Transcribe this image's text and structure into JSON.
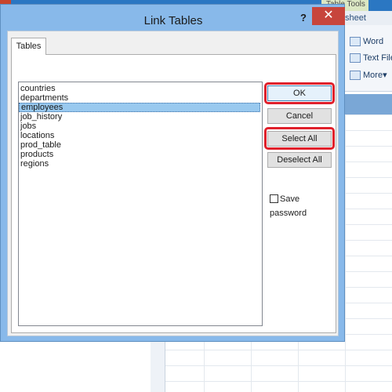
{
  "background": {
    "context_tab": "Table Tools",
    "ribbon_tab": "sheet",
    "ribbon_items": [
      "Word",
      "Text File",
      "More"
    ],
    "more_arrow": "▾",
    "close_glyph": "✕"
  },
  "dialog": {
    "title": "Link Tables",
    "help_glyph": "?",
    "close_glyph": "✕",
    "tab_label": "Tables",
    "tables": [
      {
        "name": "countries",
        "selected": false
      },
      {
        "name": "departments",
        "selected": false
      },
      {
        "name": "employees",
        "selected": true
      },
      {
        "name": "job_history",
        "selected": false
      },
      {
        "name": "jobs",
        "selected": false
      },
      {
        "name": "locations",
        "selected": false
      },
      {
        "name": "prod_table",
        "selected": false
      },
      {
        "name": "products",
        "selected": false
      },
      {
        "name": "regions",
        "selected": false
      }
    ],
    "buttons": {
      "ok": "OK",
      "cancel": "Cancel",
      "select_all": "Select All",
      "deselect_all": "Deselect All"
    },
    "save_password": {
      "label": "Save password",
      "checked": false
    }
  },
  "colors": {
    "dialog_frame": "#88b9ea",
    "close_button": "#c7453c",
    "highlight": "#e0202b",
    "selection": "#99c9ef"
  }
}
